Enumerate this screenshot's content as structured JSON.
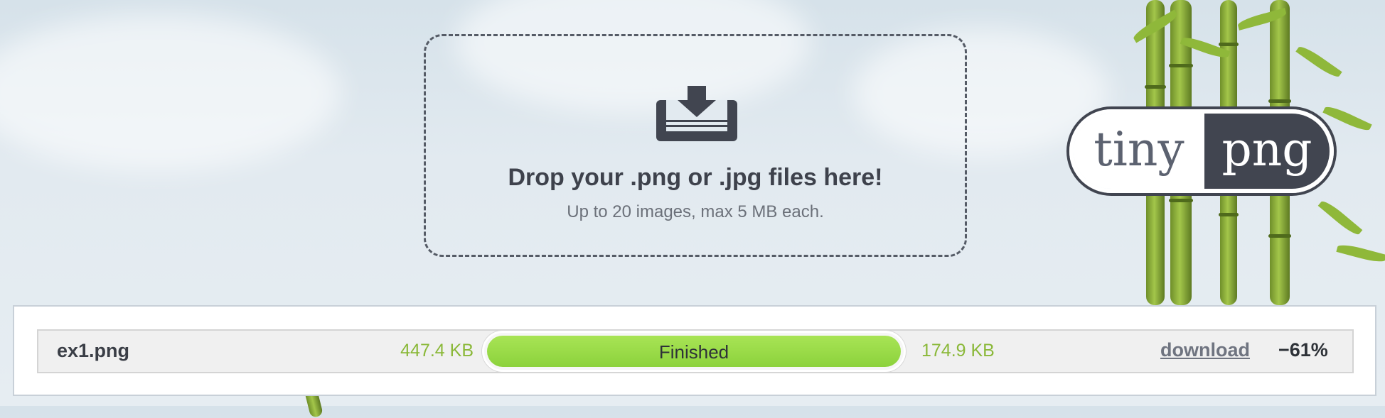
{
  "dropzone": {
    "title": "Drop your .png or .jpg files here!",
    "subtitle": "Up to 20 images, max 5 MB each.",
    "icon": "download-tray-icon"
  },
  "logo": {
    "left_text": "tiny",
    "right_text": "png"
  },
  "results": [
    {
      "file_name": "ex1.png",
      "original_size": "447.4 KB",
      "status": "Finished",
      "progress": 1.0,
      "new_size": "174.9 KB",
      "download_label": "download",
      "savings": "−61%"
    }
  ],
  "colors": {
    "accent_green": "#8ab838",
    "progress_green": "#9ddc4a",
    "dark": "#414550"
  }
}
